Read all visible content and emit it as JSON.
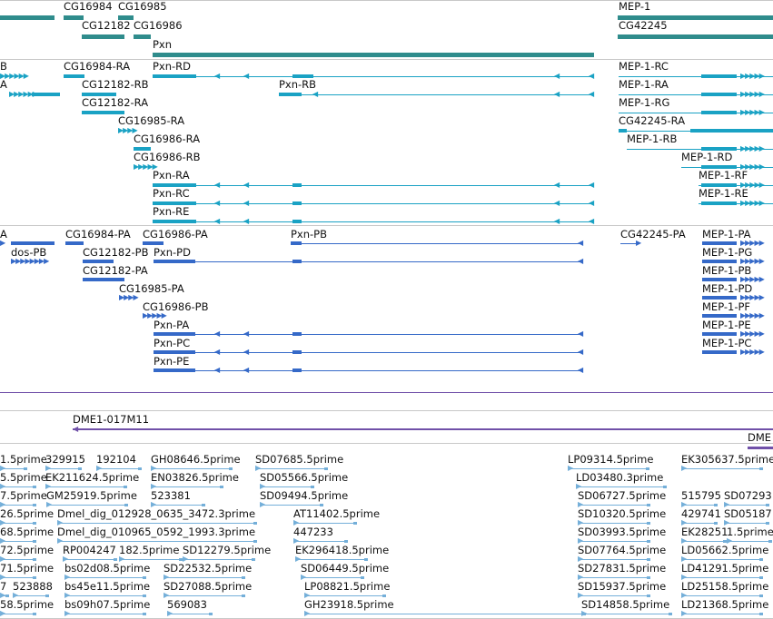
{
  "colors": {
    "gene": "#2f8c8c",
    "transcript": "#1aa2c4",
    "protein": "#3569c8",
    "clone": "#7050a8",
    "est": "#74afd9",
    "separator": "#c8c8c8"
  },
  "tracks": {
    "genes": {
      "labels": {
        "cg16984": "CG16984",
        "cg16985": "CG16985",
        "cg12182": "CG12182",
        "cg16986": "CG16986",
        "pxn": "Pxn",
        "mep1": "MEP-1",
        "cg42245": "CG42245"
      }
    },
    "transcripts": {
      "labels": {
        "b_left": "B",
        "a_left": "A",
        "cg16984_ra": "CG16984-RA",
        "pxn_rd": "Pxn-RD",
        "cg12182_rb": "CG12182-RB",
        "pxn_rb": "Pxn-RB",
        "cg12182_ra": "CG12182-RA",
        "cg16985_ra": "CG16985-RA",
        "cg16986_ra": "CG16986-RA",
        "cg16986_rb": "CG16986-RB",
        "pxn_ra": "Pxn-RA",
        "pxn_rc": "Pxn-RC",
        "pxn_re": "Pxn-RE",
        "mep1_rc": "MEP-1-RC",
        "mep1_ra": "MEP-1-RA",
        "mep1_rg": "MEP-1-RG",
        "cg42245_ra": "CG42245-RA",
        "mep1_rb": "MEP-1-RB",
        "mep1_rd": "MEP-1-RD",
        "mep1_rf": "MEP-1-RF",
        "mep1_re": "MEP-1-RE"
      }
    },
    "proteins": {
      "labels": {
        "a_left": "A",
        "dos_pb": "dos-PB",
        "cg16984_pa": "CG16984-PA",
        "cg16986_pa": "CG16986-PA",
        "pxn_pb": "Pxn-PB",
        "cg12182_pb": "CG12182-PB",
        "pxn_pd": "Pxn-PD",
        "cg12182_pa": "CG12182-PA",
        "cg16985_pa": "CG16985-PA",
        "cg16986_pb": "CG16986-PB",
        "pxn_pa": "Pxn-PA",
        "pxn_pc": "Pxn-PC",
        "pxn_pe": "Pxn-PE",
        "cg42245_pa": "CG42245-PA",
        "mep1_pa": "MEP-1-PA",
        "mep1_pg": "MEP-1-PG",
        "mep1_pb": "MEP-1-PB",
        "mep1_pd": "MEP-1-PD",
        "mep1_pf": "MEP-1-PF",
        "mep1_pe": "MEP-1-PE",
        "mep1_pc": "MEP-1-PC"
      }
    },
    "clones": {
      "labels": {
        "dme1_017m11": "DME1-017M11",
        "dme_right": "DME"
      }
    },
    "ests": {
      "labels": {
        "e_l1": "1.5prime",
        "e_329915": "329915",
        "e_192104": "192104",
        "e_gh08646": "GH08646.5prime",
        "e_sd07685": "SD07685.5prime",
        "e_lp09314": "LP09314.5prime",
        "e_ek305637": "EK305637.5prime",
        "e_l2": "5.5prime",
        "e_ek211624": "EK211624.5prime",
        "e_en03826": "EN03826.5prime",
        "e_sd05566": "SD05566.5prime",
        "e_ld03480": "LD03480.3prime",
        "e_l3": "7.5prime",
        "e_gm25919": "GM25919.5prime",
        "e_523381": "523381",
        "e_sd09494": "SD09494.5prime",
        "e_sd06727": "SD06727.5prime",
        "e_515795": "515795",
        "e_sd07293": "SD07293",
        "e_l4": "26.5prime",
        "e_dmel_012928": "Dmel_dig_012928_0635_3472.3prime",
        "e_at11402": "AT11402.5prime",
        "e_sd10320": "SD10320.5prime",
        "e_429741": "429741",
        "e_sd05187": "SD05187",
        "e_l5": "68.5prime",
        "e_dmel_010965": "Dmel_dig_010965_0592_1993.3prime",
        "e_447233": "447233",
        "e_sd03993": "SD03993.5prime",
        "e_ek28251": "EK28251",
        "e_1_5prime_b": "1.5prime",
        "e_l6": "72.5prime",
        "e_rp004247": "RP004247",
        "e_182_5prime": "182.5prime",
        "e_sd12279": "SD12279.5prime",
        "e_ek296418": "EK296418.5prime",
        "e_sd07764": "SD07764.5prime",
        "e_ld05662": "LD05662.5prime",
        "e_l7": "71.5prime",
        "e_bs02d08": "bs02d08.5prime",
        "e_sd22532": "SD22532.5prime",
        "e_sd06449": "SD06449.5prime",
        "e_sd27831": "SD27831.5prime",
        "e_ld41291": "LD41291.5prime",
        "e_l8": "7",
        "e_523888": "523888",
        "e_bs45e11": "bs45e11.5prime",
        "e_sd27088": "SD27088.5prime",
        "e_lp08821": "LP08821.5prime",
        "e_sd15937": "SD15937.5prime",
        "e_ld25158": "LD25158.5prime",
        "e_l9": "58.5prime",
        "e_bs09h07": "bs09h07.5prime",
        "e_569083": "569083",
        "e_gh23918": "GH23918.5prime",
        "e_sd14858": "SD14858.5prime",
        "e_ld21368": "LD21368.5prime"
      }
    }
  }
}
